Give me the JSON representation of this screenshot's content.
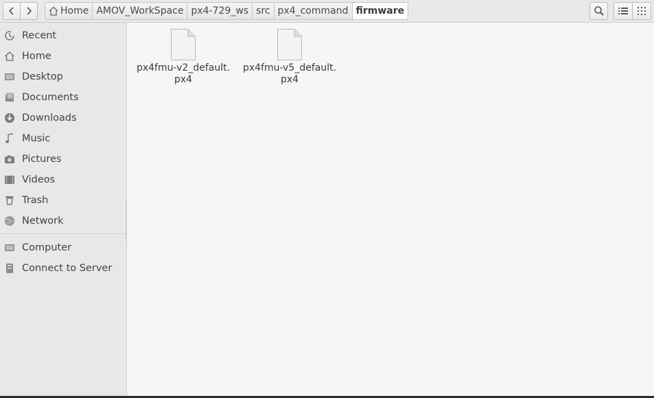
{
  "toolbar": {
    "back_icon": "chevron-left-icon",
    "forward_icon": "chevron-right-icon",
    "search_icon": "search-icon",
    "list_view_icon": "list-view-icon",
    "grid_view_icon": "grid-view-icon"
  },
  "breadcrumb": {
    "items": [
      "Home",
      "AMOV_WorkSpace",
      "px4-729_ws",
      "src",
      "px4_command",
      "firmware"
    ],
    "active_index": 5
  },
  "sidebar": {
    "places": [
      {
        "label": "Recent",
        "icon": "recent-icon"
      },
      {
        "label": "Home",
        "icon": "home-icon"
      },
      {
        "label": "Desktop",
        "icon": "desktop-icon"
      },
      {
        "label": "Documents",
        "icon": "documents-icon"
      },
      {
        "label": "Downloads",
        "icon": "downloads-icon"
      },
      {
        "label": "Music",
        "icon": "music-icon"
      },
      {
        "label": "Pictures",
        "icon": "pictures-icon"
      },
      {
        "label": "Videos",
        "icon": "videos-icon"
      },
      {
        "label": "Trash",
        "icon": "trash-icon"
      },
      {
        "label": "Network",
        "icon": "network-icon"
      }
    ],
    "devices": [
      {
        "label": "Computer",
        "icon": "computer-icon"
      },
      {
        "label": "Connect to Server",
        "icon": "server-icon"
      }
    ]
  },
  "files": [
    {
      "line1": "px4fmu-v2_default.",
      "line2": "px4",
      "icon": "file-icon"
    },
    {
      "line1": "px4fmu-v5_default.",
      "line2": "px4",
      "icon": "file-icon"
    }
  ],
  "colors": {
    "header_bg": "#e9e9e7",
    "sidebar_bg": "#e8e8e7",
    "content_bg": "#f6f6f6",
    "icon_gray": "#7a7a7a"
  }
}
